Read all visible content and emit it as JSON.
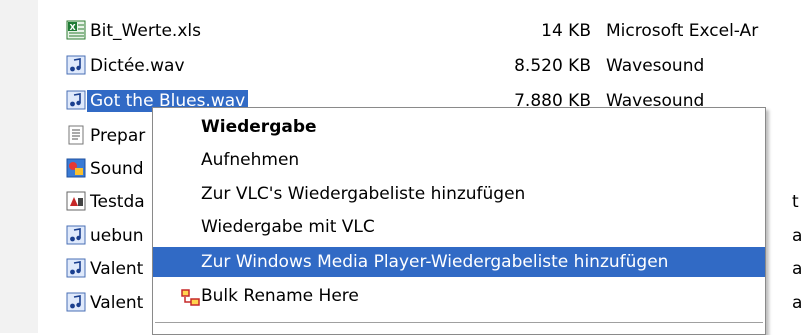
{
  "files": [
    {
      "name": "Bit_Werte.xls",
      "size": "14 KB",
      "type": "Microsoft Excel-Ar",
      "icon": "excel-icon",
      "selected": false
    },
    {
      "name": "Dictée.wav",
      "size": "8.520 KB",
      "type": "Wavesound",
      "icon": "audio-file-icon",
      "selected": false
    },
    {
      "name": "Got the Blues.wav",
      "size": "7.880 KB",
      "type": "Wavesound",
      "icon": "audio-file-icon",
      "selected": true
    },
    {
      "name": "Prepar",
      "size": "",
      "type": "",
      "icon": "text-file-icon",
      "selected": false
    },
    {
      "name": "Sound",
      "size": "",
      "type": "",
      "icon": "sound-app-icon",
      "selected": false
    },
    {
      "name": "Testda",
      "size": "",
      "type": "t F",
      "icon": "database-file-icon",
      "selected": false
    },
    {
      "name": "uebun",
      "size": "",
      "type": "at",
      "icon": "audio-file-icon",
      "selected": false
    },
    {
      "name": "Valent",
      "size": "",
      "type": "at",
      "icon": "audio-file-icon",
      "selected": false
    },
    {
      "name": "Valent",
      "size": "",
      "type": "at",
      "icon": "audio-file-icon",
      "selected": false
    }
  ],
  "context_menu": {
    "items": [
      {
        "label": "Wiedergabe",
        "bold": true,
        "highlight": false,
        "icon": ""
      },
      {
        "label": "Aufnehmen",
        "bold": false,
        "highlight": false,
        "icon": ""
      },
      {
        "label": "Zur VLC's Wiedergabeliste hinzufügen",
        "bold": false,
        "highlight": false,
        "icon": ""
      },
      {
        "label": "Wiedergabe mit VLC",
        "bold": false,
        "highlight": false,
        "icon": ""
      },
      {
        "label": "Zur Windows Media Player-Wiedergabeliste hinzufügen",
        "bold": false,
        "highlight": true,
        "icon": ""
      },
      {
        "label": "Bulk Rename Here",
        "bold": false,
        "highlight": false,
        "icon": "bulk-rename-icon"
      }
    ]
  },
  "colors": {
    "selection": "#316ac5",
    "menu_border": "#8a8a8a"
  }
}
